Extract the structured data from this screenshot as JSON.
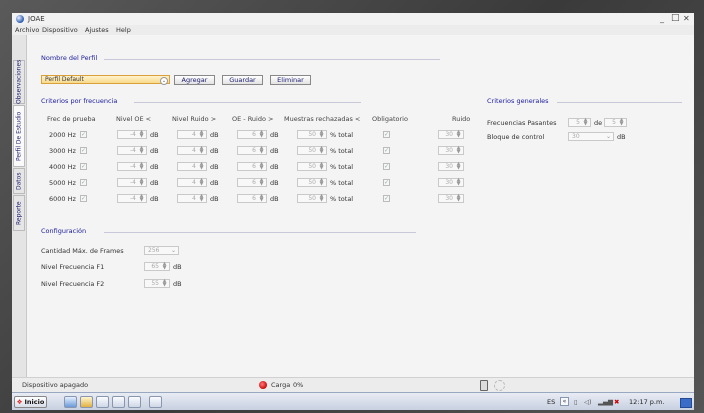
{
  "window": {
    "title": "JOAE"
  },
  "menu": [
    "Archivo",
    "Dispositivo",
    "Ajustes",
    "Help"
  ],
  "side_tabs": [
    "Reporte",
    "Datos",
    "Perfil De Estudio",
    "Observaciones"
  ],
  "profile": {
    "section_title": "Nombre del Perfil",
    "selected": "Perfil Default",
    "buttons": {
      "add": "Agregar",
      "save": "Guardar",
      "delete": "Eliminar"
    }
  },
  "frequency": {
    "section_title": "Criterios por frecuencia",
    "headers": [
      "Frec de prueba",
      "Nivel OE <",
      "Nivel Ruido >",
      "OE - Ruido >",
      "Muestras rechazadas <",
      "Obligatorio",
      "Ruido"
    ],
    "unit_db": "dB",
    "unit_total": "% total",
    "rows": [
      {
        "freq": "2000 Hz",
        "oe": "-4",
        "noise": "4",
        "diff": "6",
        "rejected": "50",
        "ruido": "30"
      },
      {
        "freq": "3000 Hz",
        "oe": "-4",
        "noise": "4",
        "diff": "6",
        "rejected": "50",
        "ruido": "30"
      },
      {
        "freq": "4000 Hz",
        "oe": "-4",
        "noise": "4",
        "diff": "6",
        "rejected": "50",
        "ruido": "30"
      },
      {
        "freq": "5000 Hz",
        "oe": "-4",
        "noise": "4",
        "diff": "6",
        "rejected": "50",
        "ruido": "30"
      },
      {
        "freq": "6000 Hz",
        "oe": "-4",
        "noise": "4",
        "diff": "6",
        "rejected": "50",
        "ruido": "30"
      }
    ]
  },
  "general": {
    "section_title": "Criterios generales",
    "pass_label": "Frecuencias Pasantes",
    "pass_value": "5",
    "pass_of": "de",
    "pass_total": "5",
    "block_label": "Bloque de control",
    "block_value": "30",
    "block_unit": "dB"
  },
  "config": {
    "section_title": "Configuración",
    "frames_label": "Cantidad Máx. de Frames",
    "frames_value": "256",
    "f1_label": "Nivel Frecuencia F1",
    "f1_value": "65",
    "f2_label": "Nivel Frecuencia F2",
    "f2_value": "55",
    "unit": "dB"
  },
  "status": {
    "device": "Dispositivo apagado",
    "load_label": "Carga",
    "load_value": "0%"
  },
  "taskbar": {
    "start": "Inicio",
    "lang": "ES",
    "time": "12:17 p.m."
  }
}
